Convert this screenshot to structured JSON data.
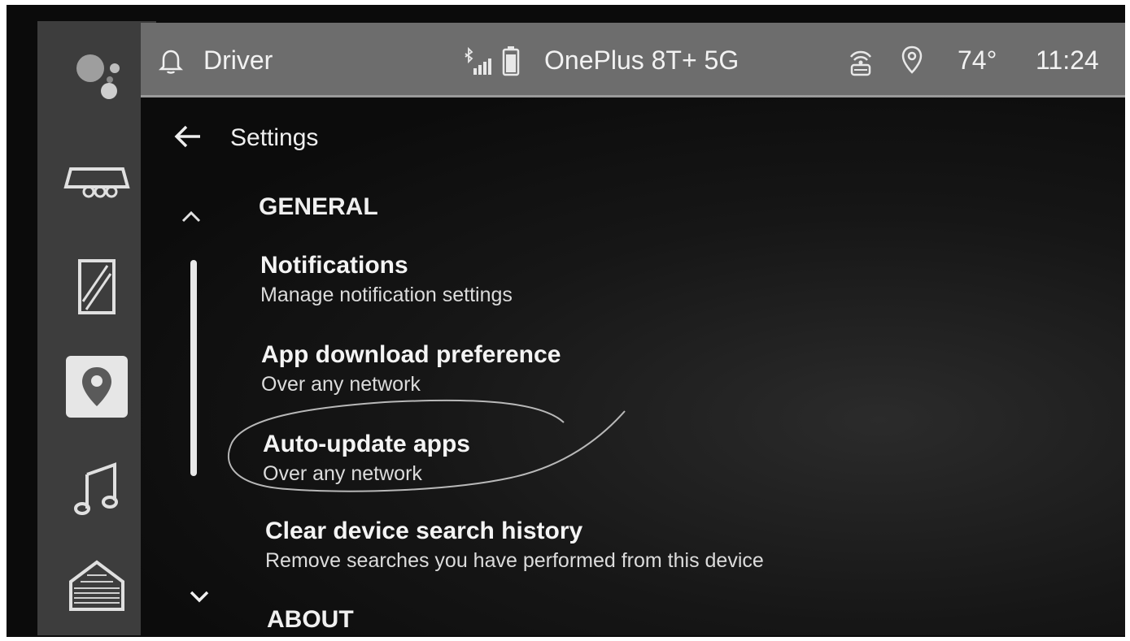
{
  "status_bar": {
    "profile_label": "Driver",
    "device_name": "OnePlus 8T+ 5G",
    "temperature": "74°",
    "time": "11:24",
    "icons": [
      "bell-icon",
      "bluetooth-signal-icon",
      "battery-icon",
      "wifi-hotspot-icon",
      "location-icon"
    ]
  },
  "rail": {
    "items": [
      "google-assistant-icon",
      "vehicle-icon",
      "phone-app-icon",
      "maps-icon",
      "music-icon",
      "home-icon"
    ]
  },
  "header": {
    "title": "Settings",
    "back_icon": "back-arrow-icon"
  },
  "sections": [
    {
      "header": "GENERAL",
      "items": [
        {
          "title": "Notifications",
          "subtitle": "Manage notification settings"
        },
        {
          "title": "App download preference",
          "subtitle": "Over any network"
        },
        {
          "title": "Auto-update apps",
          "subtitle": "Over any network"
        },
        {
          "title": "Clear device search history",
          "subtitle": "Remove searches you have performed from this device"
        }
      ]
    },
    {
      "header": "ABOUT",
      "items": []
    }
  ],
  "colors": {
    "status_bar": "#6d6d6d",
    "rail": "#3d3d3d",
    "background": "#0b0b0b",
    "text": "#f4f4f4"
  }
}
